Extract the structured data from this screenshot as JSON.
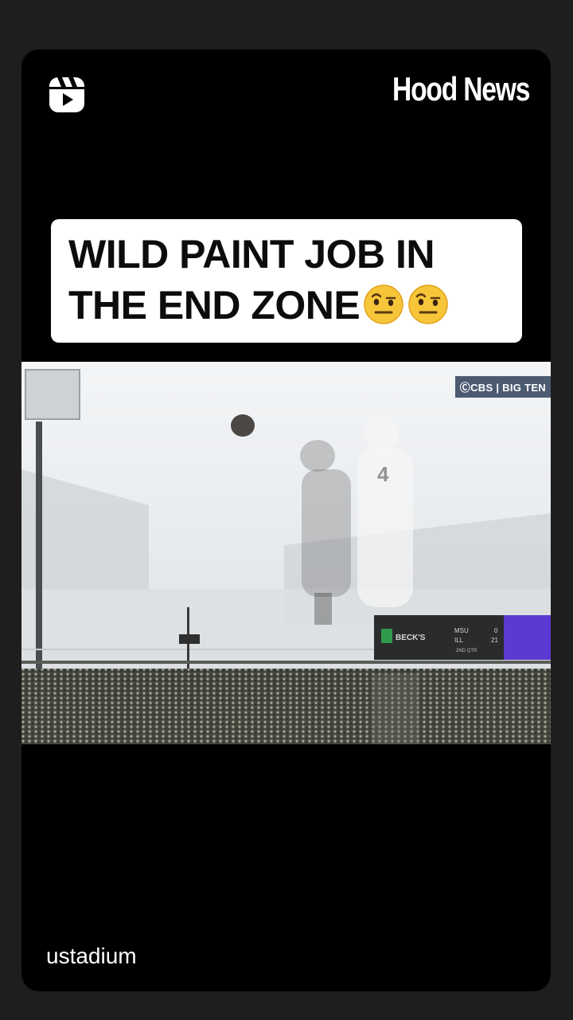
{
  "header": {
    "brand_name": "Hood News",
    "reels_icon": "reels-icon"
  },
  "caption": {
    "line1": "WILD PAINT JOB IN",
    "line2": "THE END ZONE",
    "emojis": [
      "face-with-raised-eyebrow",
      "face-with-raised-eyebrow"
    ]
  },
  "video": {
    "broadcaster_badge": "ⒸCBS | BIG TEN",
    "scoreboard": {
      "sponsor": "BECK'S",
      "team1": "MSU",
      "score1": "0",
      "team2": "ILL",
      "score2": "21",
      "period": "2ND QTR"
    }
  },
  "footer": {
    "username": "ustadium"
  },
  "colors": {
    "background": "#1e1e1e",
    "frame": "#000000",
    "caption_bg": "#ffffff",
    "caption_text": "#0c0c0c"
  }
}
